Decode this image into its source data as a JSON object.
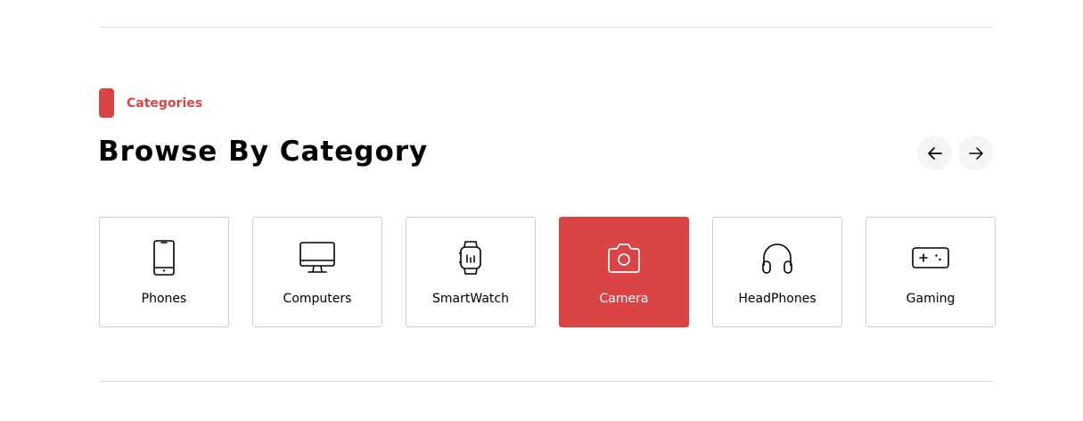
{
  "section": {
    "tag_label": "Categories",
    "title": "Browse By Category",
    "accent_color": "#db4444"
  },
  "navigation": {
    "prev_icon": "arrow-left-icon",
    "next_icon": "arrow-right-icon"
  },
  "categories": [
    {
      "label": "Phones",
      "icon": "phone-icon",
      "active": false
    },
    {
      "label": "Computers",
      "icon": "computer-icon",
      "active": false
    },
    {
      "label": "SmartWatch",
      "icon": "smartwatch-icon",
      "active": false
    },
    {
      "label": "Camera",
      "icon": "camera-icon",
      "active": true
    },
    {
      "label": "HeadPhones",
      "icon": "headphones-icon",
      "active": false
    },
    {
      "label": "Gaming",
      "icon": "gamepad-icon",
      "active": false
    }
  ]
}
